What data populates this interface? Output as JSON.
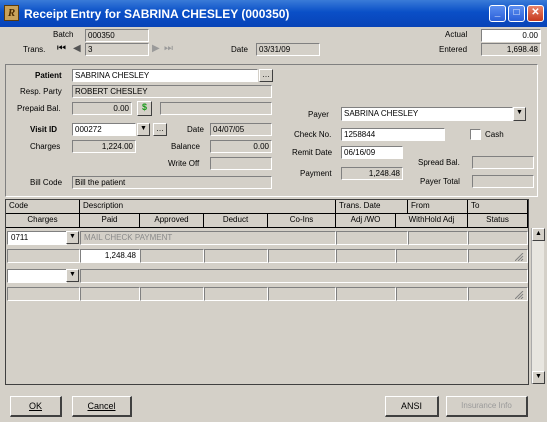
{
  "window": {
    "title": "Receipt Entry for SABRINA CHESLEY (000350)"
  },
  "header": {
    "batch_label": "Batch",
    "batch_value": "000350",
    "trans_label": "Trans.",
    "trans_value": "3",
    "date_label": "Date",
    "date_value": "03/31/09",
    "actual_label": "Actual",
    "actual_value": "0.00",
    "entered_label": "Entered",
    "entered_value": "1,698.48"
  },
  "patient": {
    "patient_label": "Patient",
    "patient_value": "SABRINA CHESLEY",
    "resp_label": "Resp. Party",
    "resp_value": "ROBERT CHESLEY",
    "prepaid_label": "Prepaid Bal.",
    "prepaid_value": "0.00",
    "prepaid_btn": "$",
    "visit_label": "Visit ID",
    "visit_value": "000272",
    "visit_date_label": "Date",
    "visit_date_value": "04/07/05",
    "charges_label": "Charges",
    "charges_value": "1,224.00",
    "balance_label": "Balance",
    "balance_value": "0.00",
    "writeoff_label": "Write Off",
    "writeoff_value": "",
    "billcode_label": "Bill Code",
    "billcode_value": "Bill the patient"
  },
  "payer": {
    "payer_label": "Payer",
    "payer_value": "SABRINA CHESLEY",
    "check_label": "Check No.",
    "check_value": "1258844",
    "cash_label": "Cash",
    "remit_label": "Remit Date",
    "remit_value": "06/16/09",
    "spread_label": "Spread Bal.",
    "spread_value": "",
    "payment_label": "Payment",
    "payment_value": "1,248.48",
    "payertotal_label": "Payer Total",
    "payertotal_value": ""
  },
  "grid": {
    "header1": {
      "code": "Code",
      "description": "Description",
      "trans_date": "Trans. Date",
      "from": "From",
      "to": "To"
    },
    "header2": [
      "Charges",
      "Paid",
      "Approved",
      "Deduct",
      "Co-Ins",
      "Adj /WO",
      "WithHold Adj",
      "Status"
    ],
    "row1": {
      "code": "0711",
      "description": "MAIL CHECK PAYMENT"
    },
    "row1b": {
      "paid": "1,248.48"
    }
  },
  "buttons": {
    "ok": "OK",
    "cancel": "Cancel",
    "ansi": "ANSI",
    "insurance_info": "Insurance Info"
  },
  "icons": {
    "first": "first-record-icon",
    "prev": "prev-record-icon",
    "next": "next-record-icon",
    "last": "last-record-icon"
  }
}
